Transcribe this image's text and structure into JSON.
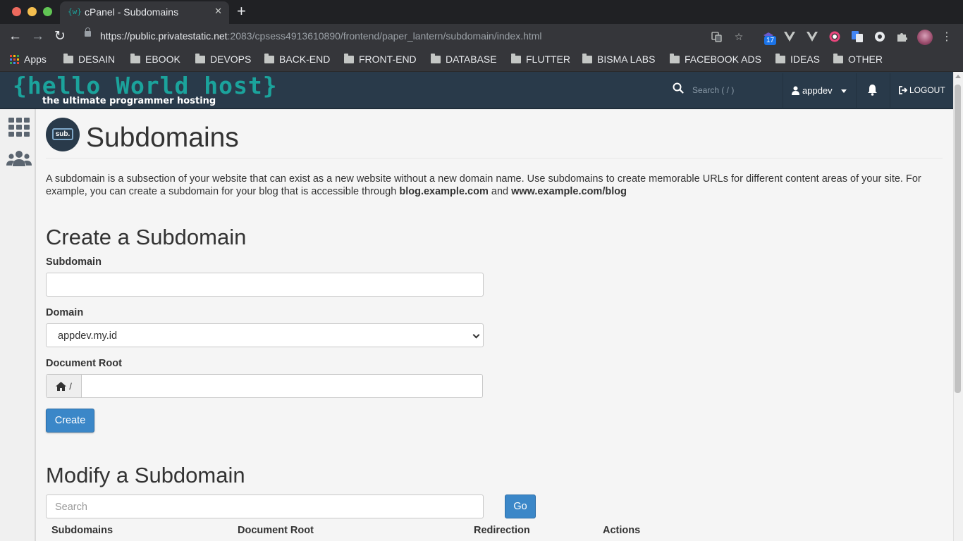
{
  "browser": {
    "tab_title": "cPanel - Subdomains",
    "tab_favicon": "{w}",
    "url_host": "https://public.privatestatic.net",
    "url_path": ":2083/cpsess4913610890/frontend/paper_lantern/subdomain/index.html",
    "extension_badge": "17",
    "bookmarks": [
      {
        "label": "Apps",
        "icon": "apps-grid-icon"
      },
      {
        "label": "DESAIN",
        "icon": "folder-icon"
      },
      {
        "label": "EBOOK",
        "icon": "folder-icon"
      },
      {
        "label": "DEVOPS",
        "icon": "folder-icon"
      },
      {
        "label": "BACK-END",
        "icon": "folder-icon"
      },
      {
        "label": "FRONT-END",
        "icon": "folder-icon"
      },
      {
        "label": "DATABASE",
        "icon": "folder-icon"
      },
      {
        "label": "FLUTTER",
        "icon": "folder-icon"
      },
      {
        "label": "BISMA LABS",
        "icon": "folder-icon"
      },
      {
        "label": "FACEBOOK ADS",
        "icon": "folder-icon"
      },
      {
        "label": "IDEAS",
        "icon": "folder-icon"
      },
      {
        "label": "OTHER",
        "icon": "folder-icon"
      }
    ]
  },
  "header": {
    "logo_main": "{hello World host}",
    "logo_sub": "the ultimate programmer hosting",
    "search_placeholder": "Search ( / )",
    "user": "appdev",
    "logout": "LOGOUT",
    "colors": {
      "bg": "#293a4a",
      "brand": "#1ba39c"
    }
  },
  "page": {
    "icon_text": "sub.",
    "title": "Subdomains",
    "description_1": "A subdomain is a subsection of your website that can exist as a new website without a new domain name. Use subdomains to create memorable URLs for different content areas of your site. For example, you can create a subdomain for your blog that is accessible through ",
    "description_bold_1": "blog.example.com",
    "description_and": " and ",
    "description_bold_2": "www.example.com/blog"
  },
  "create": {
    "heading": "Create a Subdomain",
    "subdomain_label": "Subdomain",
    "subdomain_value": "",
    "domain_label": "Domain",
    "domain_value": "appdev.my.id",
    "docroot_label": "Document Root",
    "docroot_prefix": "/",
    "docroot_value": "",
    "button": "Create"
  },
  "modify": {
    "heading": "Modify a Subdomain",
    "search_placeholder": "Search",
    "go_button": "Go",
    "columns": [
      "Subdomains",
      "Document Root",
      "Redirection",
      "Actions"
    ]
  },
  "accent_color": "#3b87c8"
}
